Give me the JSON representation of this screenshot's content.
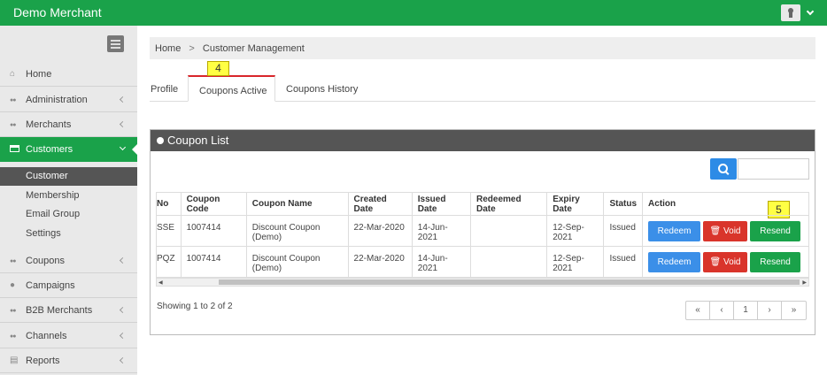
{
  "header": {
    "brand": "Demo Merchant"
  },
  "sidebar": {
    "items": [
      {
        "label": "Home"
      },
      {
        "label": "Administration"
      },
      {
        "label": "Merchants"
      },
      {
        "label": "Customers"
      },
      {
        "label": "Coupons"
      },
      {
        "label": "Campaigns"
      },
      {
        "label": "B2B Merchants"
      },
      {
        "label": "Channels"
      },
      {
        "label": "Reports"
      }
    ],
    "subitems": [
      {
        "label": "Customer"
      },
      {
        "label": "Membership"
      },
      {
        "label": "Email Group"
      },
      {
        "label": "Settings"
      }
    ]
  },
  "breadcrumb": {
    "home": "Home",
    "sep": ">",
    "current": "Customer Management"
  },
  "tabs": [
    {
      "label": "Profile"
    },
    {
      "label": "Coupons Active"
    },
    {
      "label": "Coupons History"
    }
  ],
  "annotations": {
    "a4": "4",
    "a5": "5"
  },
  "panel": {
    "title": "Coupon List"
  },
  "table": {
    "headers": [
      "No",
      "Coupon Code",
      "Coupon Name",
      "Created Date",
      "Issued Date",
      "Redeemed Date",
      "Expiry Date",
      "Status",
      "Action"
    ],
    "rows": [
      [
        "SSE",
        "1007414",
        "Discount Coupon (Demo)",
        "22-Mar-2020",
        "14-Jun-2021",
        "",
        "12-Sep-2021",
        "Issued"
      ],
      [
        "PQZ",
        "1007414",
        "Discount Coupon (Demo)",
        "22-Mar-2020",
        "14-Jun-2021",
        "",
        "12-Sep-2021",
        "Issued"
      ]
    ],
    "actions": {
      "redeem": "Redeem",
      "void": "Void",
      "resend": "Resend"
    }
  },
  "footer": {
    "showing": "Showing 1 to 2 of 2",
    "pager": [
      "«",
      "‹",
      "1",
      "›",
      "»"
    ]
  },
  "colors": {
    "brand": "#1aa24a",
    "redeem": "#3b8fe8",
    "void": "#d9342b",
    "resend": "#1aa24a",
    "tab_accent": "#d9262a"
  }
}
